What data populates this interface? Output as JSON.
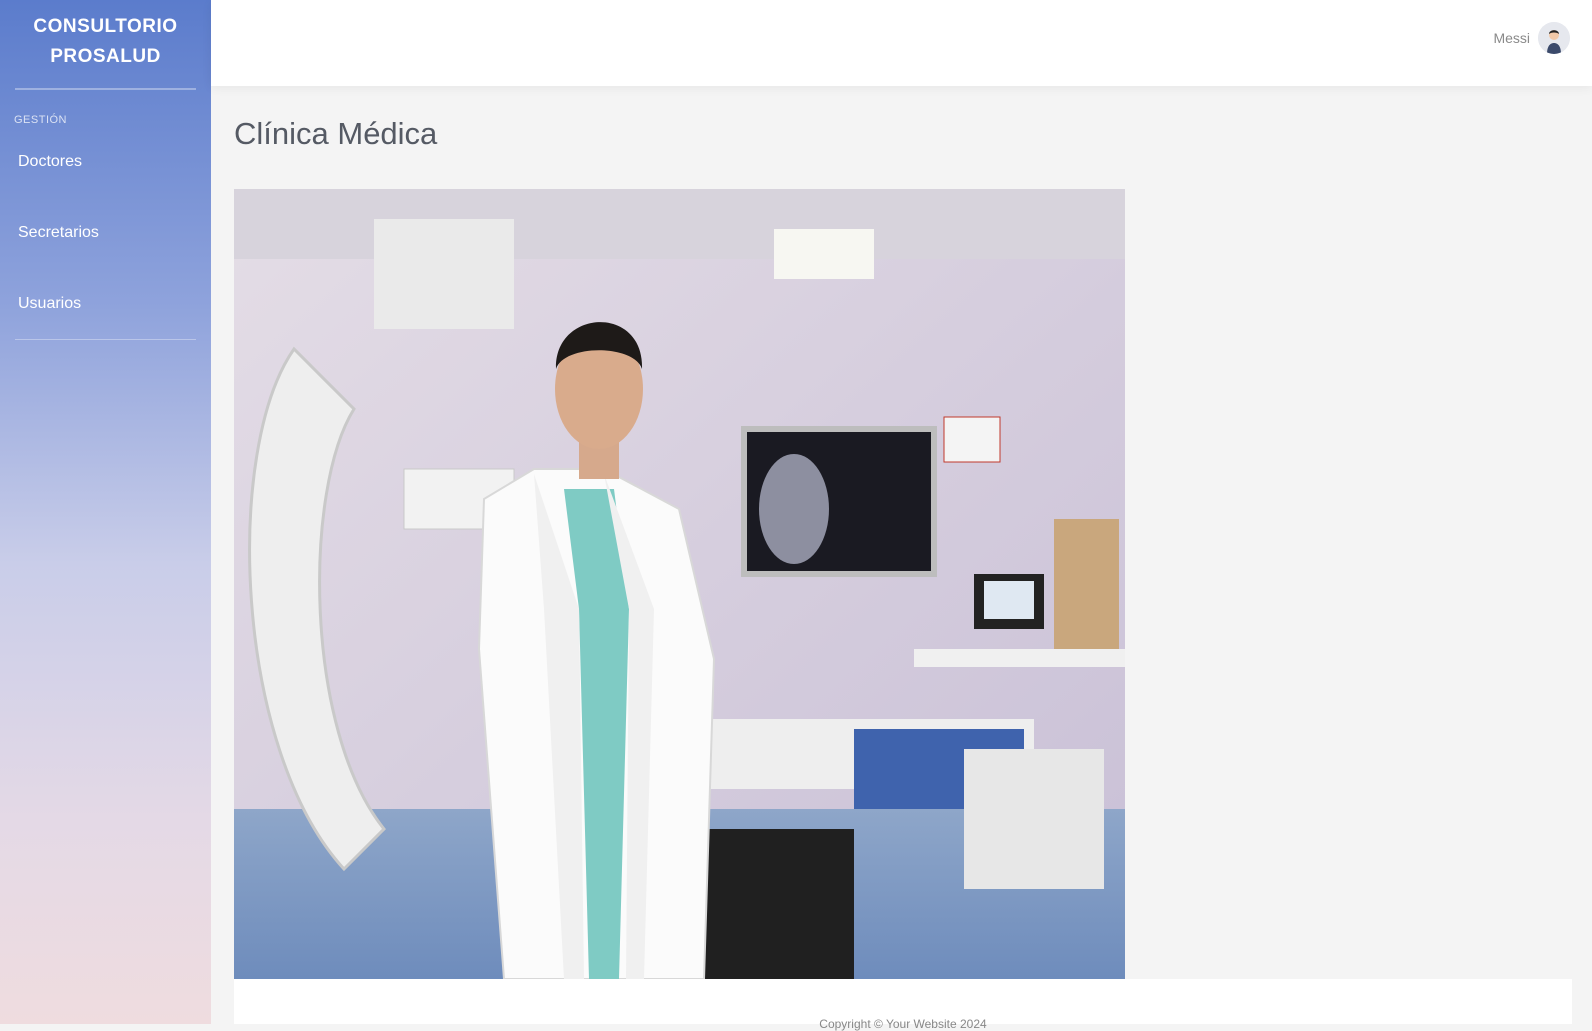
{
  "sidebar": {
    "brand_line1": "CONSULTORIO",
    "brand_line2": "PROSALUD",
    "section_label": "GESTIÓN",
    "items": [
      {
        "label": "Doctores"
      },
      {
        "label": "Secretarios"
      },
      {
        "label": "Usuarios"
      }
    ]
  },
  "topbar": {
    "user_name": "Messi",
    "avatar_icon": "user-avatar-icon"
  },
  "main": {
    "title": "Clínica Médica",
    "image_icon": "doctor-photo"
  },
  "footer": {
    "copyright": "Copyright © Your Website 2024"
  },
  "colors": {
    "sidebar_top": "#5b7ccc",
    "sidebar_bottom": "#efdcdf",
    "topbar_bg": "#ffffff",
    "content_bg": "#f4f4f4"
  }
}
